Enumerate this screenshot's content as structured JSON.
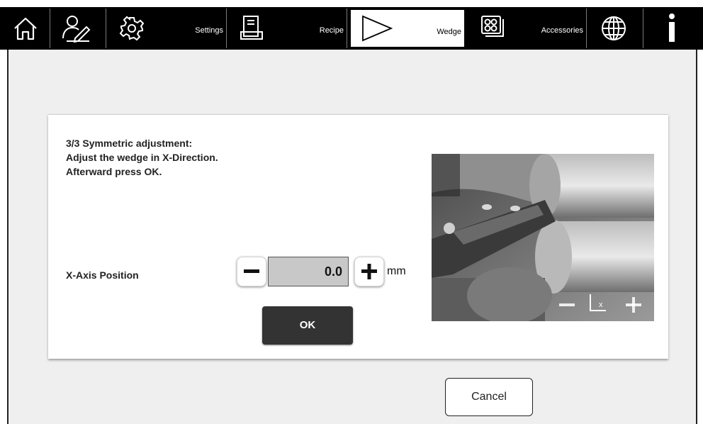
{
  "toolbar": {
    "items": [
      {
        "icon": "home-icon",
        "label": ""
      },
      {
        "icon": "user-edit-icon",
        "label": ""
      },
      {
        "icon": "gear-icon",
        "label": "Settings"
      },
      {
        "icon": "recipe-icon",
        "label": "Recipe"
      },
      {
        "icon": "wedge-icon",
        "label": "Wedge",
        "active": true
      },
      {
        "icon": "accessories-icon",
        "label": "Accessories"
      },
      {
        "icon": "globe-icon",
        "label": ""
      },
      {
        "icon": "info-icon",
        "label": ""
      }
    ]
  },
  "dialog": {
    "instructions": [
      "3/3 Symmetric adjustment:",
      "Adjust the wedge in X-Direction.",
      "Afterward press OK."
    ],
    "axis_label": "X-Axis Position",
    "position_value": "0.0",
    "unit": "mm",
    "ok_label": "OK",
    "image_controls": [
      "zoom-out-icon",
      "x-axis-icon",
      "zoom-in-icon"
    ]
  },
  "footer": {
    "cancel_label": "Cancel"
  },
  "colors": {
    "toolbar_bg": "#000000",
    "content_bg": "#efefef",
    "ok_button_bg": "#333333",
    "value_box_bg": "#c8c8c8"
  }
}
